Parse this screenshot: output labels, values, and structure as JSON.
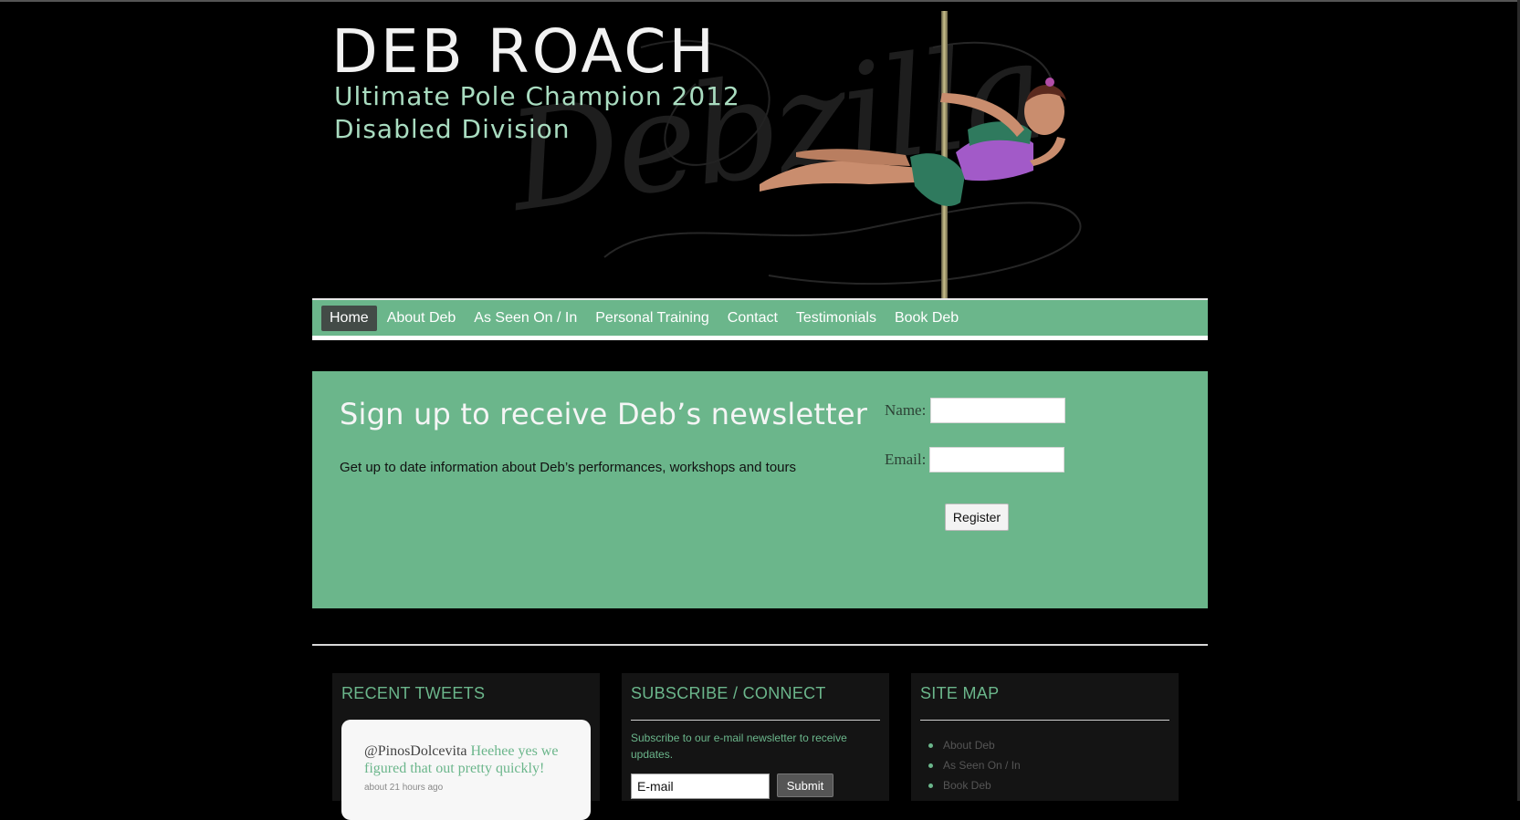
{
  "header": {
    "title": "DEB ROACH",
    "tagline_line1": "Ultimate Pole Champion 2012",
    "tagline_line2": "Disabled Division",
    "script_word": "Debzilla"
  },
  "nav": {
    "items": [
      {
        "label": "Home",
        "active": true
      },
      {
        "label": "About Deb"
      },
      {
        "label": "As Seen On / In"
      },
      {
        "label": "Personal Training"
      },
      {
        "label": "Contact"
      },
      {
        "label": "Testimonials"
      },
      {
        "label": "Book Deb"
      }
    ]
  },
  "newsletter": {
    "heading": "Sign up to receive Deb’s newsletter",
    "description": "Get up to date information about Deb’s performances, workshops and tours",
    "name_label": "Name:",
    "email_label": "Email:",
    "name_value": "",
    "email_value": "",
    "register_label": "Register"
  },
  "widgets": {
    "tweets": {
      "title": "RECENT TWEETS",
      "user": "@PinosDolcevita",
      "text": " Heehee yes we figured that out pretty quickly!",
      "time": "about 21 hours ago"
    },
    "subscribe": {
      "title": "SUBSCRIBE / CONNECT",
      "text": "Subscribe to our e-mail newsletter to receive updates.",
      "email_value": "E-mail",
      "submit_label": "Submit"
    },
    "sitemap": {
      "title": "SITE MAP",
      "links": [
        "About Deb",
        "As Seen On / In",
        "Book Deb"
      ]
    }
  },
  "colors": {
    "accent": "#6bb68b",
    "background": "#000000",
    "nav_active": "#434b47"
  }
}
